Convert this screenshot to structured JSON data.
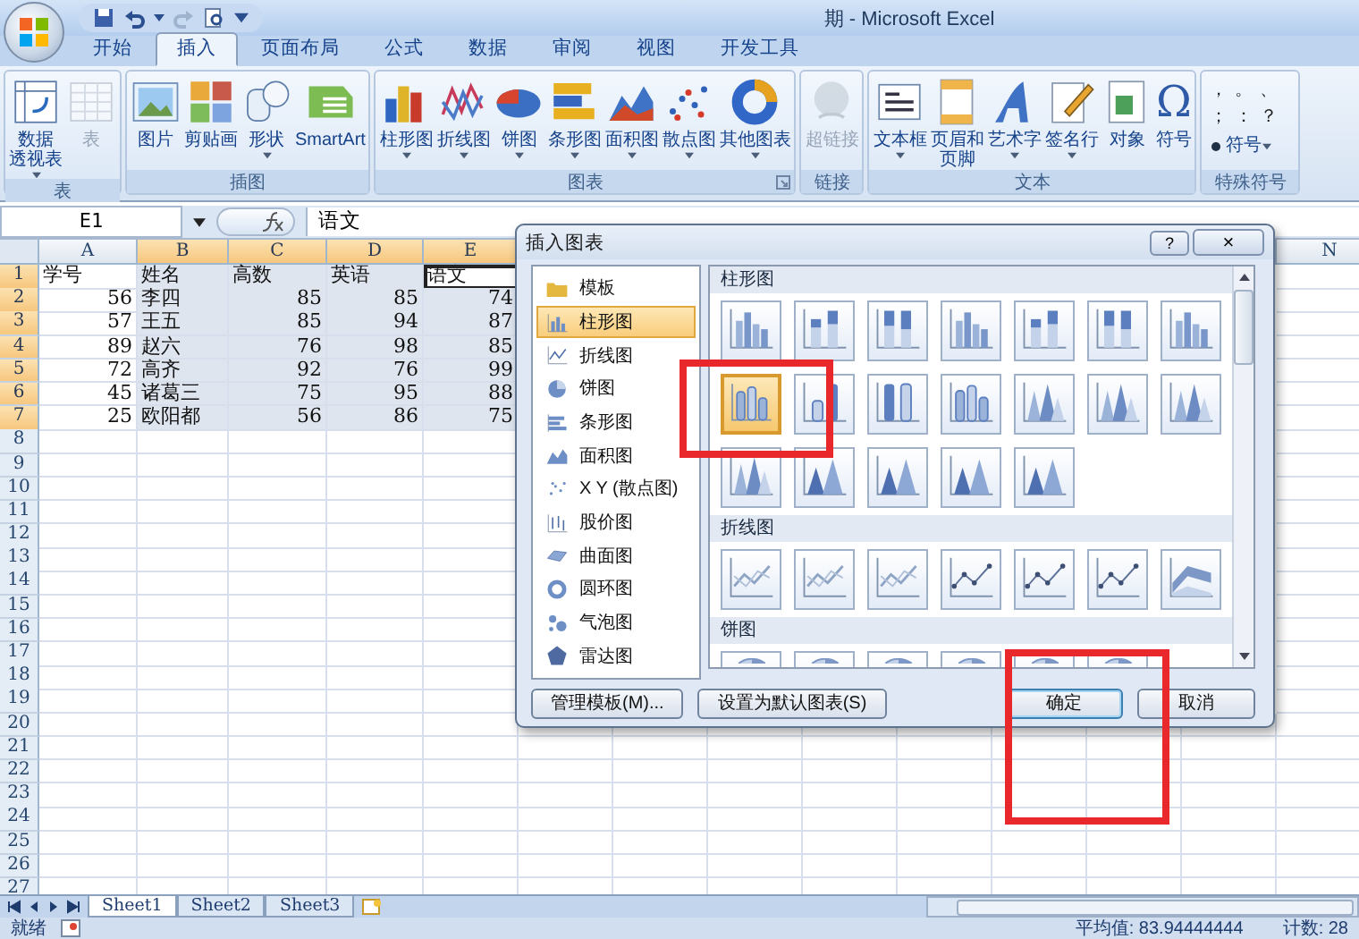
{
  "window": {
    "title": "期 - Microsoft Excel"
  },
  "ribbon_tabs": [
    {
      "label": "开始",
      "selected": false
    },
    {
      "label": "插入",
      "selected": true
    },
    {
      "label": "页面布局",
      "selected": false
    },
    {
      "label": "公式",
      "selected": false
    },
    {
      "label": "数据",
      "selected": false
    },
    {
      "label": "审阅",
      "selected": false
    },
    {
      "label": "视图",
      "selected": false
    },
    {
      "label": "开发工具",
      "selected": false
    }
  ],
  "ribbon_groups": [
    {
      "label": "表",
      "launcher": false,
      "items": [
        {
          "lines": [
            "数据",
            "透视表"
          ],
          "dropdown": true,
          "disabled": false
        },
        {
          "lines": [
            "表"
          ],
          "dropdown": false,
          "disabled": true
        }
      ]
    },
    {
      "label": "插图",
      "launcher": false,
      "items": [
        {
          "lines": [
            "图片"
          ],
          "dropdown": false,
          "disabled": false
        },
        {
          "lines": [
            "剪贴画"
          ],
          "dropdown": false,
          "disabled": false
        },
        {
          "lines": [
            "形状"
          ],
          "dropdown": true,
          "disabled": false
        },
        {
          "lines": [
            "SmartArt"
          ],
          "dropdown": false,
          "disabled": false
        }
      ]
    },
    {
      "label": "图表",
      "launcher": true,
      "items": [
        {
          "lines": [
            "柱形图"
          ],
          "dropdown": true,
          "disabled": false
        },
        {
          "lines": [
            "折线图"
          ],
          "dropdown": true,
          "disabled": false
        },
        {
          "lines": [
            "饼图"
          ],
          "dropdown": true,
          "disabled": false
        },
        {
          "lines": [
            "条形图"
          ],
          "dropdown": true,
          "disabled": false
        },
        {
          "lines": [
            "面积图"
          ],
          "dropdown": true,
          "disabled": false
        },
        {
          "lines": [
            "散点图"
          ],
          "dropdown": true,
          "disabled": false
        },
        {
          "lines": [
            "其他图表"
          ],
          "dropdown": true,
          "disabled": false
        }
      ]
    },
    {
      "label": "链接",
      "launcher": false,
      "items": [
        {
          "lines": [
            "超链接"
          ],
          "dropdown": false,
          "disabled": true
        }
      ]
    },
    {
      "label": "文本",
      "launcher": false,
      "items": [
        {
          "lines": [
            "文本框"
          ],
          "dropdown": true,
          "disabled": false
        },
        {
          "lines": [
            "页眉和",
            "页脚"
          ],
          "dropdown": false,
          "disabled": false
        },
        {
          "lines": [
            "艺术字"
          ],
          "dropdown": true,
          "disabled": false
        },
        {
          "lines": [
            "签名行"
          ],
          "dropdown": true,
          "disabled": false
        },
        {
          "lines": [
            "对象"
          ],
          "dropdown": false,
          "disabled": false
        },
        {
          "lines": [
            "符号"
          ],
          "glyph": "Ω",
          "dropdown": false,
          "disabled": false
        }
      ]
    },
    {
      "label": "特殊符号",
      "launcher": false,
      "symbols": [
        "，",
        "。",
        "、",
        "；",
        "：",
        "？"
      ],
      "items": [
        {
          "lines": [
            "符号"
          ],
          "dropdown": true,
          "disabled": false
        }
      ]
    }
  ],
  "formula_bar": {
    "name_box": "E1",
    "formula": "语文"
  },
  "columns": [
    {
      "label": "A",
      "selected": false
    },
    {
      "label": "B",
      "selected": true
    },
    {
      "label": "C",
      "selected": true
    },
    {
      "label": "D",
      "selected": true
    },
    {
      "label": "E",
      "selected": true
    }
  ],
  "far_columns": [
    {
      "label": "N",
      "selected": false
    }
  ],
  "rows": [
    {
      "number": "1",
      "selected": true,
      "kind": "header",
      "cells": [
        {
          "text": "学号",
          "active": false
        },
        {
          "text": "姓名",
          "active": false
        },
        {
          "text": "高数",
          "active": false
        },
        {
          "text": "英语",
          "active": false
        },
        {
          "text": "语文",
          "active": true
        }
      ]
    },
    {
      "number": "2",
      "selected": true,
      "kind": "data",
      "cells": [
        {
          "text": "56",
          "active": false
        },
        {
          "text": "李四",
          "active": false
        },
        {
          "text": "85",
          "active": false
        },
        {
          "text": "85",
          "active": false
        },
        {
          "text": "74",
          "active": false
        }
      ]
    },
    {
      "number": "3",
      "selected": true,
      "kind": "data",
      "cells": [
        {
          "text": "57",
          "active": false
        },
        {
          "text": "王五",
          "active": false
        },
        {
          "text": "85",
          "active": false
        },
        {
          "text": "94",
          "active": false
        },
        {
          "text": "87",
          "active": false
        }
      ]
    },
    {
      "number": "4",
      "selected": true,
      "kind": "data",
      "cells": [
        {
          "text": "89",
          "active": false
        },
        {
          "text": "赵六",
          "active": false
        },
        {
          "text": "76",
          "active": false
        },
        {
          "text": "98",
          "active": false
        },
        {
          "text": "85",
          "active": false
        }
      ]
    },
    {
      "number": "5",
      "selected": true,
      "kind": "data",
      "cells": [
        {
          "text": "72",
          "active": false
        },
        {
          "text": "高齐",
          "active": false
        },
        {
          "text": "92",
          "active": false
        },
        {
          "text": "76",
          "active": false
        },
        {
          "text": "99",
          "active": false
        }
      ]
    },
    {
      "number": "6",
      "selected": true,
      "kind": "data",
      "cells": [
        {
          "text": "45",
          "active": false
        },
        {
          "text": "诸葛三",
          "active": false
        },
        {
          "text": "75",
          "active": false
        },
        {
          "text": "95",
          "active": false
        },
        {
          "text": "88",
          "active": false
        }
      ]
    },
    {
      "number": "7",
      "selected": true,
      "kind": "data",
      "cells": [
        {
          "text": "25",
          "active": false
        },
        {
          "text": "欧阳都",
          "active": false
        },
        {
          "text": "56",
          "active": false
        },
        {
          "text": "86",
          "active": false
        },
        {
          "text": "75",
          "active": false
        }
      ]
    },
    {
      "number": "8",
      "selected": false,
      "kind": "empty"
    },
    {
      "number": "9",
      "selected": false,
      "kind": "empty"
    },
    {
      "number": "10",
      "selected": false,
      "kind": "empty"
    },
    {
      "number": "11",
      "selected": false,
      "kind": "empty"
    },
    {
      "number": "12",
      "selected": false,
      "kind": "empty"
    },
    {
      "number": "13",
      "selected": false,
      "kind": "empty"
    },
    {
      "number": "14",
      "selected": false,
      "kind": "empty"
    },
    {
      "number": "15",
      "selected": false,
      "kind": "empty"
    },
    {
      "number": "16",
      "selected": false,
      "kind": "empty"
    },
    {
      "number": "17",
      "selected": false,
      "kind": "empty"
    },
    {
      "number": "18",
      "selected": false,
      "kind": "empty"
    },
    {
      "number": "19",
      "selected": false,
      "kind": "empty"
    },
    {
      "number": "20",
      "selected": false,
      "kind": "empty"
    },
    {
      "number": "21",
      "selected": false,
      "kind": "empty"
    },
    {
      "number": "22",
      "selected": false,
      "kind": "empty"
    },
    {
      "number": "23",
      "selected": false,
      "kind": "empty"
    },
    {
      "number": "24",
      "selected": false,
      "kind": "empty"
    },
    {
      "number": "25",
      "selected": false,
      "kind": "empty"
    },
    {
      "number": "26",
      "selected": false,
      "kind": "empty"
    },
    {
      "number": "27",
      "selected": false,
      "kind": "empty"
    }
  ],
  "sheet_tabs": [
    {
      "label": "Sheet1",
      "selected": true
    },
    {
      "label": "Sheet2",
      "selected": false
    },
    {
      "label": "Sheet3",
      "selected": false
    }
  ],
  "status_bar": {
    "mode": "就绪",
    "stats": [
      "平均值: 83.94444444",
      "计数: 28"
    ]
  },
  "dialog": {
    "title": "插入图表",
    "help": "?",
    "close": "×",
    "categories": [
      {
        "label": "模板",
        "selected": false
      },
      {
        "label": "柱形图",
        "selected": true
      },
      {
        "label": "折线图",
        "selected": false
      },
      {
        "label": "饼图",
        "selected": false
      },
      {
        "label": "条形图",
        "selected": false
      },
      {
        "label": "面积图",
        "selected": false
      },
      {
        "label": "X Y (散点图)",
        "selected": false
      },
      {
        "label": "股价图",
        "selected": false
      },
      {
        "label": "曲面图",
        "selected": false
      },
      {
        "label": "圆环图",
        "selected": false
      },
      {
        "label": "气泡图",
        "selected": false
      },
      {
        "label": "雷达图",
        "selected": false
      }
    ],
    "sections": [
      {
        "title": "柱形图",
        "thumbs": [
          {
            "kind": "bars",
            "selected": false
          },
          {
            "kind": "stacked",
            "selected": false
          },
          {
            "kind": "full",
            "selected": false
          },
          {
            "kind": "bars",
            "selected": false
          },
          {
            "kind": "stacked",
            "selected": false
          },
          {
            "kind": "full",
            "selected": false
          },
          {
            "kind": "bars",
            "selected": false
          },
          {
            "kind": "cyl",
            "selected": true
          },
          {
            "kind": "cylstack",
            "selected": false
          },
          {
            "kind": "cylfull",
            "selected": false
          },
          {
            "kind": "cyl",
            "selected": false
          },
          {
            "kind": "cone",
            "selected": false
          },
          {
            "kind": "cone",
            "selected": false
          },
          {
            "kind": "cone",
            "selected": false
          },
          {
            "kind": "cone",
            "selected": false
          },
          {
            "kind": "pyramid",
            "selected": false
          },
          {
            "kind": "pyramid",
            "selected": false
          },
          {
            "kind": "pyramid",
            "selected": false
          },
          {
            "kind": "pyramid",
            "selected": false
          }
        ]
      },
      {
        "title": "折线图",
        "thumbs": [
          {
            "kind": "line",
            "selected": false
          },
          {
            "kind": "line",
            "selected": false
          },
          {
            "kind": "line",
            "selected": false
          },
          {
            "kind": "markers",
            "selected": false
          },
          {
            "kind": "markers",
            "selected": false
          },
          {
            "kind": "markers",
            "selected": false
          },
          {
            "kind": "ribbon",
            "selected": false
          }
        ]
      },
      {
        "title": "饼图",
        "thumbs": [
          {
            "kind": "pie",
            "selected": false
          },
          {
            "kind": "pie",
            "selected": false
          },
          {
            "kind": "pie",
            "selected": false
          },
          {
            "kind": "pie",
            "selected": false
          },
          {
            "kind": "pie",
            "selected": false
          },
          {
            "kind": "pie",
            "selected": false
          }
        ]
      }
    ],
    "buttons": [
      "管理模板(M)...",
      "设置为默认图表(S)",
      "确定",
      "取消"
    ]
  }
}
